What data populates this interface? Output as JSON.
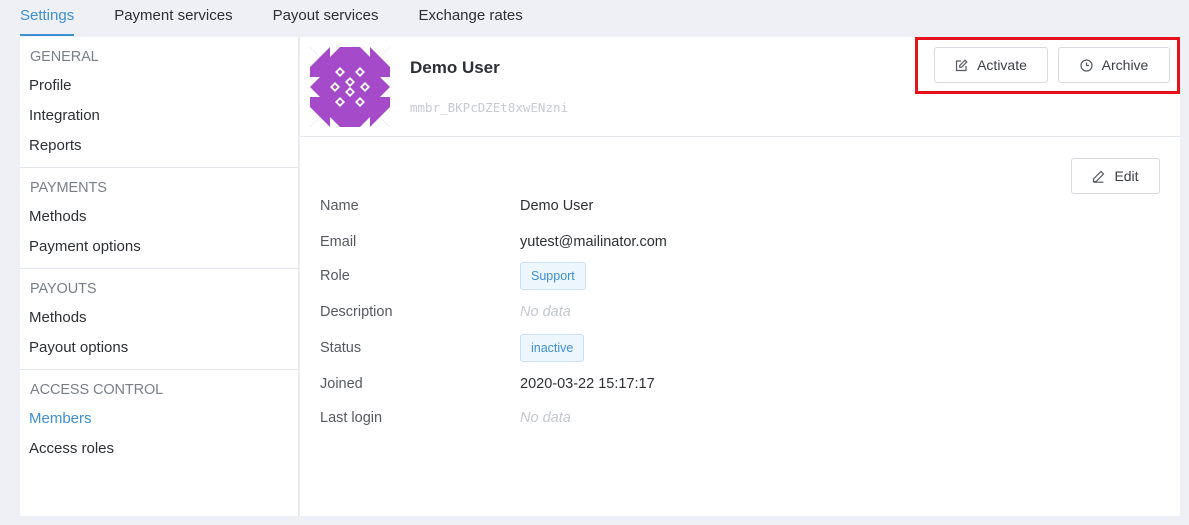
{
  "topnav": {
    "tabs": [
      {
        "label": "Settings",
        "active": true
      },
      {
        "label": "Payment services",
        "active": false
      },
      {
        "label": "Payout services",
        "active": false
      },
      {
        "label": "Exchange rates",
        "active": false
      }
    ]
  },
  "sidebar": {
    "sections": [
      {
        "heading": "GENERAL",
        "items": [
          "Profile",
          "Integration",
          "Reports"
        ]
      },
      {
        "heading": "PAYMENTS",
        "items": [
          "Methods",
          "Payment options"
        ]
      },
      {
        "heading": "PAYOUTS",
        "items": [
          "Methods",
          "Payout options"
        ]
      },
      {
        "heading": "ACCESS CONTROL",
        "items": [
          "Members",
          "Access roles"
        ]
      }
    ],
    "active_item": "Members"
  },
  "member": {
    "name": "Demo User",
    "id": "mmbr_BKPcDZEt8xwENzni",
    "avatar_color": "#a54bc9",
    "avatar_icon": "identicon-avatar"
  },
  "actions": {
    "activate_label": "Activate",
    "activate_icon": "edit-square-icon",
    "archive_label": "Archive",
    "archive_icon": "clock-icon",
    "edit_label": "Edit",
    "edit_icon": "pencil-icon",
    "highlight_color": "#e5121b"
  },
  "details": {
    "name": {
      "label": "Name",
      "value": "Demo User"
    },
    "email": {
      "label": "Email",
      "value": "yutest@mailinator.com"
    },
    "role": {
      "label": "Role",
      "value": "Support"
    },
    "description": {
      "label": "Description",
      "value": "No data"
    },
    "status": {
      "label": "Status",
      "value": "inactive"
    },
    "joined": {
      "label": "Joined",
      "value": "2020-03-22 15:17:17"
    },
    "last_login": {
      "label": "Last login",
      "value": "No data"
    }
  },
  "colors": {
    "accent": "#3d8fd4",
    "badge_bg": "#eef6fd",
    "muted": "#c4c8ce"
  }
}
